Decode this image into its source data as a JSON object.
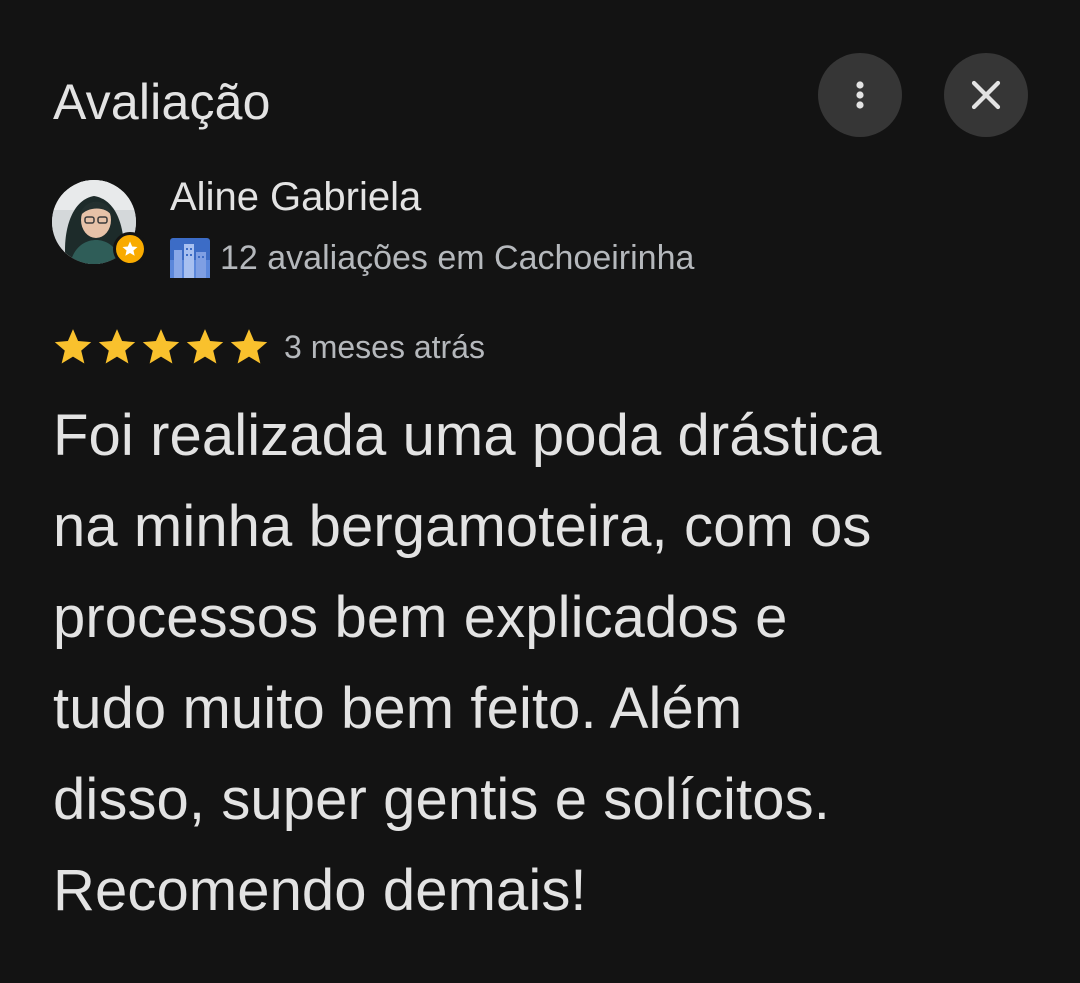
{
  "header": {
    "title": "Avaliação",
    "more_icon": "more-vert-icon",
    "close_icon": "close-icon"
  },
  "reviewer": {
    "name": "Aline Gabriela",
    "avatar_icon": "avatar",
    "badge_icon": "local-guide-star-icon",
    "location_icon": "city-icon",
    "meta": "12 avaliações em Cachoeirinha"
  },
  "rating": {
    "stars": 5,
    "max": 5,
    "star_color": "#f9c12d",
    "time": "3 meses atrás"
  },
  "review": {
    "lines": [
      "Foi realizada uma poda drástica",
      "na minha bergamoteira, com os",
      "processos bem explicados e",
      "tudo muito bem feito. Além",
      "disso, super gentis e solícitos.",
      "Recomendo demais!"
    ]
  },
  "colors": {
    "background": "#131313",
    "button_bg": "#363636",
    "text_primary": "#e3e3e3",
    "text_secondary": "#b5b8bc"
  }
}
